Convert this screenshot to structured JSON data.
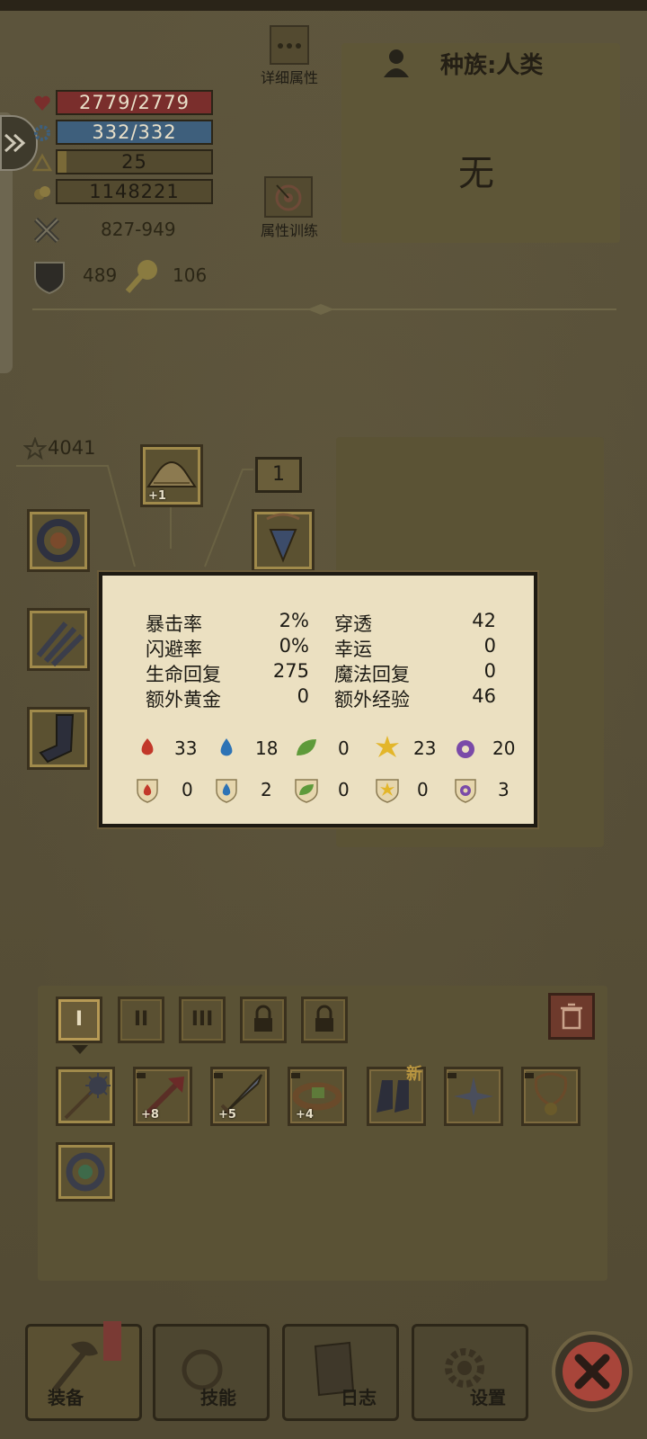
{
  "stats": {
    "hp": "2779/2779",
    "mp": "332/332",
    "level": "25",
    "gold": "1148221",
    "attack": "827-949",
    "defense": "489",
    "resist": "106"
  },
  "buttons": {
    "detail_attributes": "详细属性",
    "attribute_training": "属性训练"
  },
  "race": {
    "label": "种族:人类",
    "value": "无"
  },
  "score": "4041",
  "equipment": {
    "helmet_plus": "+1",
    "level_box": "1"
  },
  "popup": {
    "stats": [
      {
        "label": "暴击率",
        "value": "2%"
      },
      {
        "label": "闪避率",
        "value": "0%"
      },
      {
        "label": "生命回复",
        "value": "275"
      },
      {
        "label": "额外黄金",
        "value": "0"
      },
      {
        "label": "穿透",
        "value": "42"
      },
      {
        "label": "幸运",
        "value": "0"
      },
      {
        "label": "魔法回复",
        "value": "0"
      },
      {
        "label": "额外经验",
        "value": "46"
      }
    ],
    "element_attack": [
      "33",
      "18",
      "0",
      "23",
      "20"
    ],
    "element_resist": [
      "0",
      "2",
      "0",
      "0",
      "3"
    ]
  },
  "inventory": {
    "tabs": [
      "I",
      "II",
      "III"
    ],
    "new_badge": "新",
    "item_plus": [
      "+8",
      "+5",
      "+4"
    ]
  },
  "nav": {
    "equipment": "装备",
    "skills": "技能",
    "log": "日志",
    "settings": "设置"
  },
  "colors": {
    "hp_bar": "#7a2e2c",
    "mp_bar": "#3e5f7c",
    "popup_bg": "#ebe0c1",
    "close_button": "#a8453a"
  }
}
